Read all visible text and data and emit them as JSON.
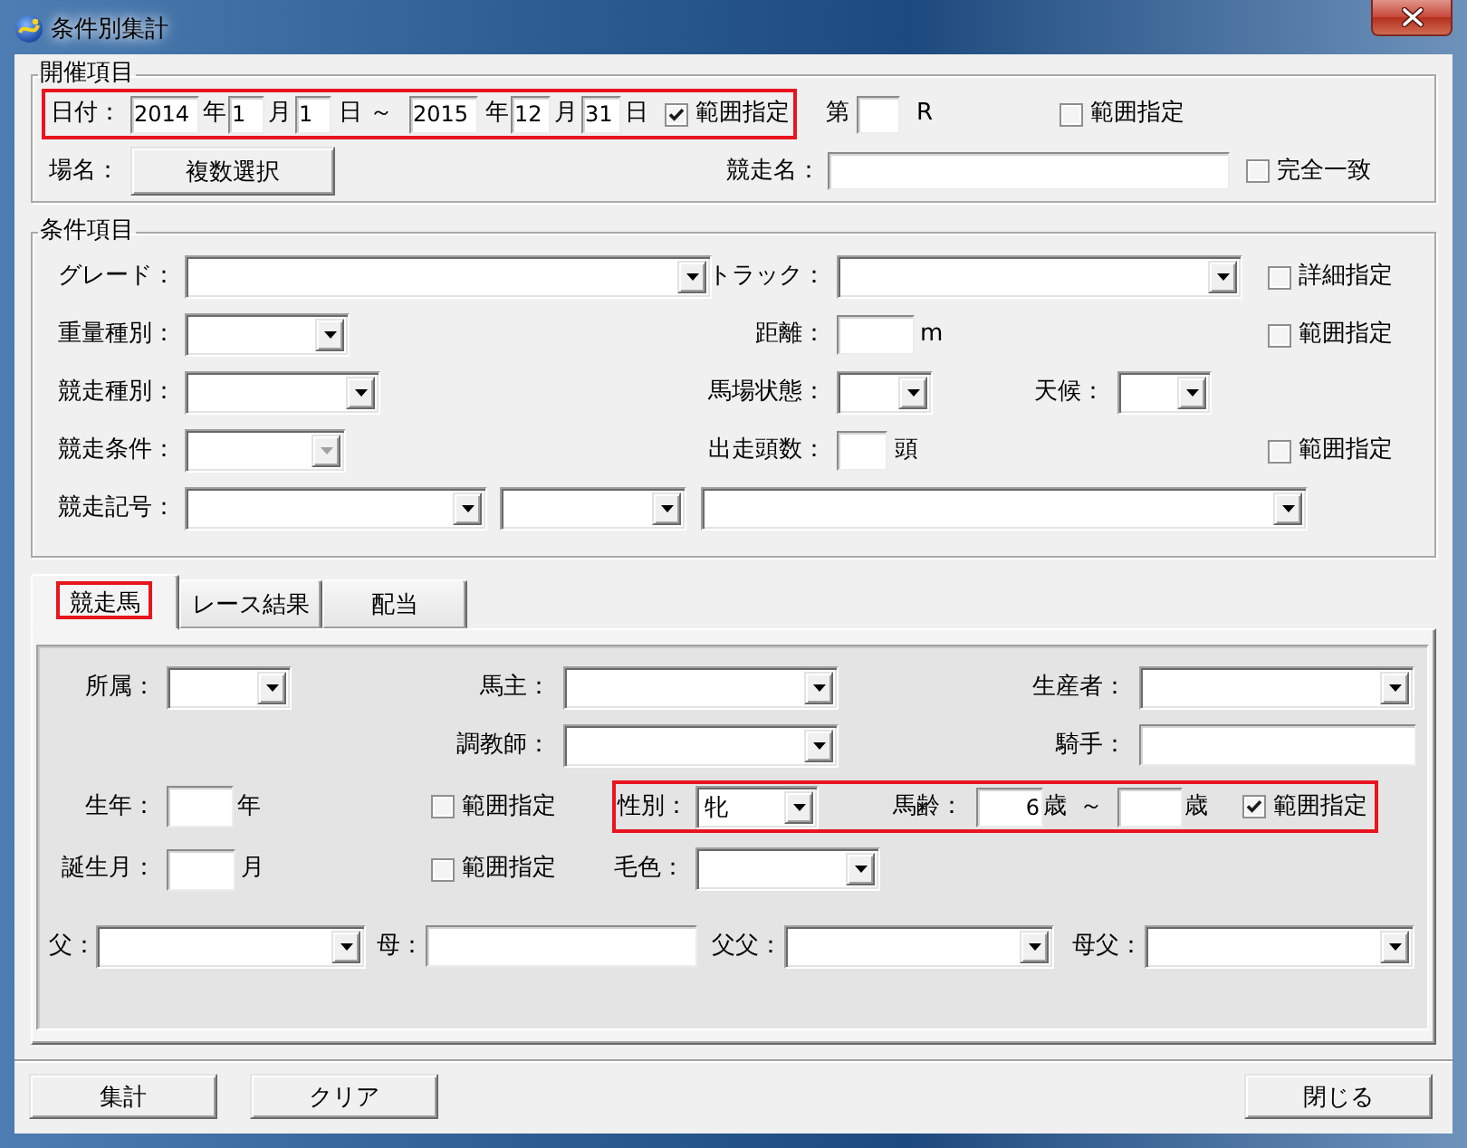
{
  "window": {
    "title": "条件別集計"
  },
  "meeting": {
    "legend": "開催項目",
    "rows": [
      {
        "items": [
          {
            "kind": "group",
            "highlighted": true,
            "items": [
              {
                "kind": "label",
                "text": "日付："
              },
              {
                "kind": "input",
                "value": "2014"
              },
              {
                "kind": "unit",
                "text": "年"
              },
              {
                "kind": "input",
                "value": "1"
              },
              {
                "kind": "unit",
                "text": "月"
              },
              {
                "kind": "input",
                "value": "1"
              },
              {
                "kind": "unit",
                "text": "日"
              },
              {
                "kind": "unit",
                "text": "～"
              },
              {
                "kind": "input",
                "value": "2015"
              },
              {
                "kind": "unit",
                "text": "年"
              },
              {
                "kind": "input",
                "value": "12"
              },
              {
                "kind": "unit",
                "text": "月"
              },
              {
                "kind": "input",
                "value": "31"
              },
              {
                "kind": "unit",
                "text": "日"
              },
              {
                "kind": "checkbox",
                "label": "範囲指定",
                "checked": true
              }
            ]
          },
          {
            "kind": "unit",
            "text": "第"
          },
          {
            "kind": "input"
          },
          {
            "kind": "unit",
            "text": "R"
          },
          {
            "kind": "checkbox",
            "label": "範囲指定",
            "checked": false
          }
        ]
      },
      {
        "items": [
          {
            "kind": "label",
            "text": "場名："
          },
          {
            "kind": "button",
            "label": "複数選択"
          },
          {
            "kind": "label",
            "text": "競走名："
          },
          {
            "kind": "input"
          },
          {
            "kind": "checkbox",
            "label": "完全一致",
            "checked": false
          }
        ]
      }
    ]
  },
  "conditions": {
    "legend": "条件項目",
    "rows": [
      {
        "items": [
          {
            "kind": "label",
            "text": "グレード："
          },
          {
            "kind": "combo",
            "disabled": false
          },
          {
            "kind": "label",
            "text": "トラック："
          },
          {
            "kind": "combo",
            "disabled": false
          },
          {
            "kind": "checkbox",
            "label": "詳細指定",
            "checked": false
          }
        ]
      },
      {
        "items": [
          {
            "kind": "label",
            "text": "重量種別："
          },
          {
            "kind": "combo",
            "disabled": false
          },
          {
            "kind": "label",
            "text": "距離："
          },
          {
            "kind": "input"
          },
          {
            "kind": "unit",
            "text": "m"
          },
          {
            "kind": "checkbox",
            "label": "範囲指定",
            "checked": false
          }
        ]
      },
      {
        "items": [
          {
            "kind": "label",
            "text": "競走種別："
          },
          {
            "kind": "combo",
            "disabled": false
          },
          {
            "kind": "label",
            "text": "馬場状態："
          },
          {
            "kind": "combo",
            "disabled": false
          },
          {
            "kind": "label",
            "text": "天候："
          },
          {
            "kind": "combo",
            "disabled": false
          }
        ]
      },
      {
        "items": [
          {
            "kind": "label",
            "text": "競走条件："
          },
          {
            "kind": "combo",
            "disabled": true
          },
          {
            "kind": "label",
            "text": "出走頭数："
          },
          {
            "kind": "input"
          },
          {
            "kind": "unit",
            "text": "頭"
          },
          {
            "kind": "checkbox",
            "label": "範囲指定",
            "checked": false
          }
        ]
      },
      {
        "items": [
          {
            "kind": "label",
            "text": "競走記号："
          },
          {
            "kind": "combo",
            "disabled": false
          },
          {
            "kind": "combo",
            "disabled": false
          },
          {
            "kind": "combo",
            "disabled": false
          }
        ]
      }
    ]
  },
  "tabs": [
    {
      "label": "競走馬",
      "selected": true,
      "highlighted": true
    },
    {
      "label": "レース結果",
      "selected": false,
      "highlighted": false
    },
    {
      "label": "配当",
      "selected": false,
      "highlighted": false
    }
  ],
  "horse": {
    "rows": [
      {
        "items": [
          {
            "kind": "label",
            "text": "所属："
          },
          {
            "kind": "combo",
            "disabled": false
          },
          {
            "kind": "label",
            "text": "馬主："
          },
          {
            "kind": "combo",
            "disabled": false
          },
          {
            "kind": "label",
            "text": "生産者："
          },
          {
            "kind": "combo",
            "disabled": false
          }
        ]
      },
      {
        "items": [
          {
            "kind": "label",
            "text": "調教師："
          },
          {
            "kind": "combo",
            "disabled": false
          },
          {
            "kind": "label",
            "text": "騎手："
          },
          {
            "kind": "input"
          }
        ]
      },
      {
        "items": [
          {
            "kind": "label",
            "text": "生年："
          },
          {
            "kind": "input"
          },
          {
            "kind": "unit",
            "text": "年"
          },
          {
            "kind": "checkbox",
            "label": "範囲指定",
            "checked": false
          },
          {
            "kind": "group",
            "highlighted": true,
            "items": [
              {
                "kind": "label",
                "text": "性別："
              },
              {
                "kind": "combo",
                "value": "牝",
                "disabled": false
              },
              {
                "kind": "label",
                "text": "馬齢："
              },
              {
                "kind": "input",
                "value": "6"
              },
              {
                "kind": "unit",
                "text": "歳"
              },
              {
                "kind": "unit",
                "text": "～"
              },
              {
                "kind": "input"
              },
              {
                "kind": "unit",
                "text": "歳"
              },
              {
                "kind": "checkbox",
                "label": "範囲指定",
                "checked": true
              }
            ]
          }
        ]
      },
      {
        "items": [
          {
            "kind": "label",
            "text": "誕生月："
          },
          {
            "kind": "input"
          },
          {
            "kind": "unit",
            "text": "月"
          },
          {
            "kind": "checkbox",
            "label": "範囲指定",
            "checked": false
          },
          {
            "kind": "label",
            "text": "毛色："
          },
          {
            "kind": "combo",
            "disabled": false
          }
        ]
      },
      {
        "items": [
          {
            "kind": "label",
            "text": "父："
          },
          {
            "kind": "combo",
            "disabled": false
          },
          {
            "kind": "label",
            "text": "母："
          },
          {
            "kind": "input"
          },
          {
            "kind": "label",
            "text": "父父："
          },
          {
            "kind": "combo",
            "disabled": false
          },
          {
            "kind": "label",
            "text": "母父："
          },
          {
            "kind": "combo",
            "disabled": false
          }
        ]
      }
    ]
  },
  "buttons": [
    {
      "label": "集計"
    },
    {
      "label": "クリア"
    },
    {
      "label": "閉じる"
    }
  ]
}
